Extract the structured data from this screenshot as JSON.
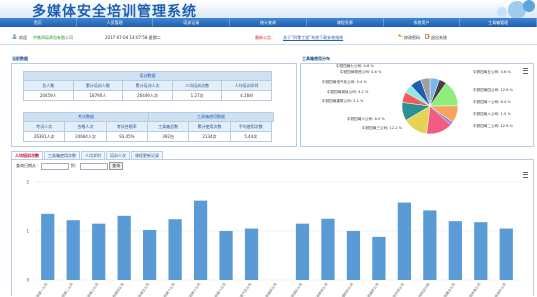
{
  "header": {
    "title": "多媒体安全培训管理系统"
  },
  "nav": [
    "首页",
    "人员管理",
    "培训记录",
    "统计查询",
    "课程资源",
    "系统用户",
    "工具箱管理"
  ],
  "infobar": {
    "welcome_label": "欢迎",
    "company": "中铁四局承包有限公司",
    "datetime": "2017-07-04 14:07:58 星期二",
    "notice_label": "最新公告：",
    "notice_link": "关于“四零工程”系统下载安装指南",
    "password_btn": "修改密码",
    "logout_btn": "退出系统"
  },
  "stats": {
    "title": "当前数据",
    "train_group": "培训数据",
    "train_headers": [
      "总人数",
      "累计培训人数",
      "累计培训人次",
      "人均培训次数",
      "人均培训学时"
    ],
    "train_values": [
      "20459人",
      "18790人",
      "26449人次",
      "1.27次",
      "4.16时"
    ],
    "exam_group": "考试数据",
    "tool_group": "工具箱使用数据",
    "bottom_headers": [
      "考试人次",
      "合格人次",
      "考试合格率",
      "工具箱总数",
      "累计使用次数",
      "平均使用次数"
    ],
    "bottom_values": [
      "26391人次",
      "24664人次",
      "93.45%",
      "392台",
      "2134次",
      "5.44次"
    ]
  },
  "pie_panel": {
    "title": "工具箱使用分布",
    "labels": [
      "中铁四局七公司: 4.6 %",
      "中铁四局五公司: 3.6 %",
      "中铁四局四公司: 12.8 %",
      "中铁四局一公司: 8.4 %",
      "中铁四局八公司: 1.5 %",
      "中铁四局二公司: 12.8 %",
      "中铁四局三公司: 12.2 %",
      "中铁四局六公司: 8.9 %",
      "中铁四局建筑公司: 5.1 %",
      "中铁四局城轨公司: 4.2 %",
      "中铁四局电气化公司: 5.4 %",
      "中铁四局物资公司: 4.6 %"
    ]
  },
  "tabs": [
    "人均培训次数",
    "工具箱使用次数",
    "人均学时",
    "培训人次",
    "课程更新记录"
  ],
  "filter": {
    "range_label": "查询日期从：",
    "to_label": "到：",
    "query_btn": "查询"
  },
  "colors": {
    "brand": "#1f5fb0",
    "bar": "#5b9bd5"
  },
  "chart_data": {
    "type": "bar",
    "ylim": [
      0,
      2
    ],
    "yticks": [
      "2",
      "1",
      "0"
    ],
    "values": [
      1.35,
      1.22,
      1.15,
      1.31,
      1.02,
      1.24,
      1.62,
      1.0,
      1.05,
      0,
      1.15,
      1.25,
      1.0,
      0.88,
      1.58,
      1.42,
      1.2,
      1.18,
      1.05
    ],
    "categories": [
      "中铁四局第一公司",
      "中铁四局第二公司",
      "中铁四局第三公司",
      "中铁四局第四公司",
      "中铁四局第五公司",
      "中铁四局第六公司",
      "中铁四局第七公司",
      "中铁四局第八公司",
      "中铁四局电气化公司",
      "中铁四局建筑公司",
      "中铁四局城轨公司",
      "中铁四局物资公司",
      "中铁四局钢结构公司",
      "中铁四局路桥公司",
      "中铁四局市政公司",
      "中铁四局设计院",
      "中铁四局置业公司",
      "中铁四局机电公司",
      "中铁四局海外公司"
    ]
  }
}
